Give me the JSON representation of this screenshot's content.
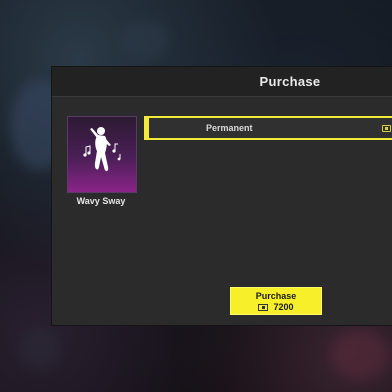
{
  "dialog": {
    "title": "Purchase"
  },
  "item": {
    "name": "Wavy Sway",
    "icon": "dancing-figure-icon"
  },
  "option": {
    "label": "Permanent",
    "currency_icon": "coin-icon",
    "selected": true
  },
  "purchase_button": {
    "label": "Purchase",
    "price": "7200",
    "currency_icon": "coin-icon"
  },
  "colors": {
    "accent": "#f6ef2a",
    "dialog_bg": "#2b2b2b",
    "item_card": "#8a2488"
  }
}
